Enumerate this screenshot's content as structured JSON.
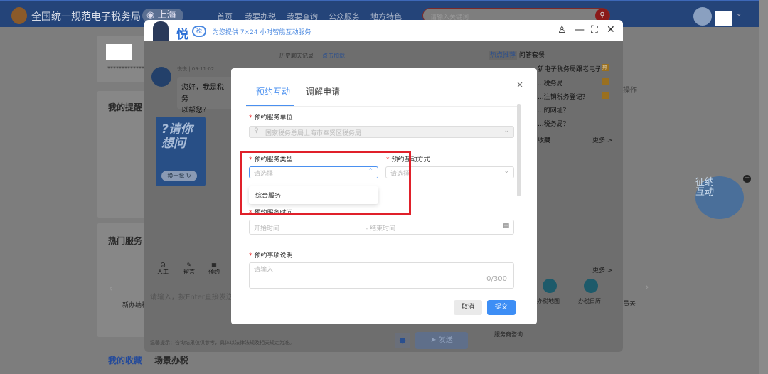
{
  "header": {
    "site_title": "全国统一规范电子税务局",
    "city": "上海",
    "nav": [
      "首页",
      "我要办税",
      "我要查询",
      "公众服务",
      "地方特色"
    ],
    "search_placeholder": "请输入关键词"
  },
  "page": {
    "masked": "**************",
    "reminders_title": "我的提醒",
    "hot_services_title": "热门服务",
    "hot_service_item": "新办纳税",
    "tabs": [
      "我的收藏",
      "场景办税"
    ],
    "right_items": [
      "办税地图",
      "办税日历",
      "员关",
      "服务商咨询"
    ],
    "more": "更多 >",
    "op_text": "操作",
    "collect": "收藏",
    "mascot_text": "征纳互动"
  },
  "chat": {
    "brand": "悦",
    "badge": "税",
    "slogan": "为您提供 7×24 小时智能互动服务",
    "history": "历史聊天记录",
    "load": "点击加载",
    "sender": "悦悦 | 09:11:02",
    "greeting": "您好，我是税务...以帮您？",
    "greeting_l1": "您好，我是税务",
    "greeting_l2": "以帮您？",
    "ask_card": "?请你想问",
    "refresh": "换一批",
    "tools": [
      "人工",
      "留言",
      "预约"
    ],
    "input_placeholder": "请输入，按Enter直接发送",
    "tip": "温馨提示：咨询结果仅供参考，具体以法律法规及相关规定为准。",
    "send": "发送",
    "side_tabs": [
      "热点推荐",
      "问答套餐"
    ],
    "side_items": [
      "新电子税务局跟老电子税务局有...",
      "...税务局",
      "...注销税务登记？",
      "...的网址？",
      "...税务局？"
    ],
    "side_badge": "热",
    "side_collect": "收藏",
    "side_more": "更多 >"
  },
  "modal": {
    "tabs": [
      "预约互动",
      "调解申请"
    ],
    "unit_label": "预约服务单位",
    "unit_value": "国家税务总局上海市奉贤区税务局",
    "type_label": "预约服务类型",
    "type_placeholder": "请选择",
    "mode_label": "预约互动方式",
    "mode_placeholder": "请选择",
    "dropdown_options": [
      "综合服务"
    ],
    "time_label": "预约服务时间",
    "start_placeholder": "开始时间",
    "end_placeholder": "结束时间",
    "desc_label": "预约事项说明",
    "desc_placeholder": "请输入",
    "counter": "0/300",
    "cancel": "取消",
    "submit": "提交"
  }
}
